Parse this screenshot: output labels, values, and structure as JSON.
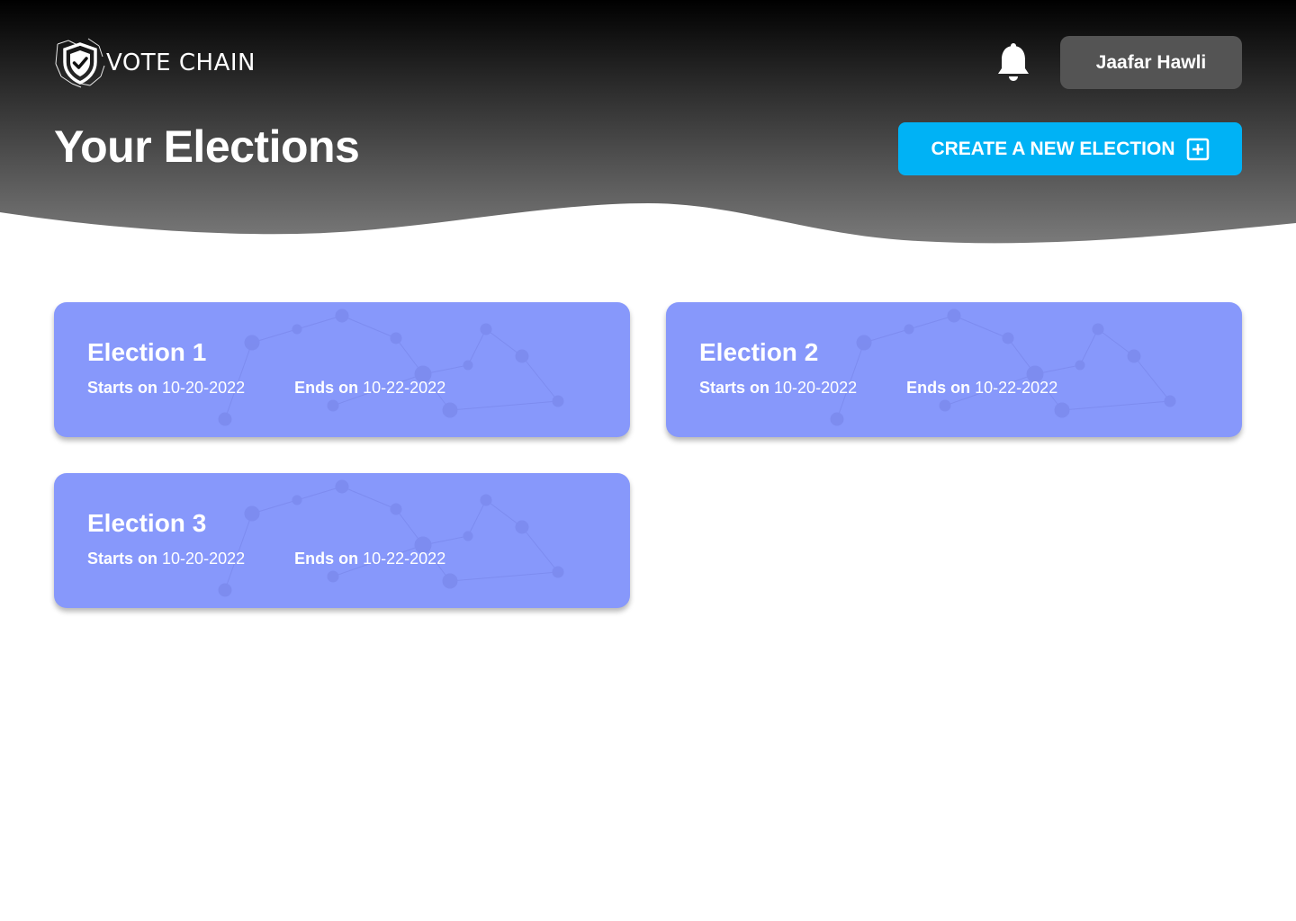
{
  "header": {
    "logo_text": "VOTE CHAIN",
    "user_name": "Jaafar Hawli",
    "page_title": "Your Elections",
    "create_button_label": "CREATE A NEW ELECTION",
    "gradient_top": "#000000",
    "gradient_bottom": "#747474"
  },
  "colors": {
    "card_bg": "#8798fb",
    "create_button": "#00b2f5",
    "user_button": "#545454"
  },
  "icons": {
    "logo": "shield-check-icon",
    "notifications": "bell-icon",
    "create": "plus-square-icon"
  },
  "elections": [
    {
      "title": "Election 1",
      "starts_label": "Starts on",
      "starts_date": "10-20-2022",
      "ends_label": "Ends on",
      "ends_date": "10-22-2022"
    },
    {
      "title": "Election 2",
      "starts_label": "Starts on",
      "starts_date": "10-20-2022",
      "ends_label": "Ends on",
      "ends_date": "10-22-2022"
    },
    {
      "title": "Election 3",
      "starts_label": "Starts on",
      "starts_date": "10-20-2022",
      "ends_label": "Ends on",
      "ends_date": "10-22-2022"
    }
  ]
}
